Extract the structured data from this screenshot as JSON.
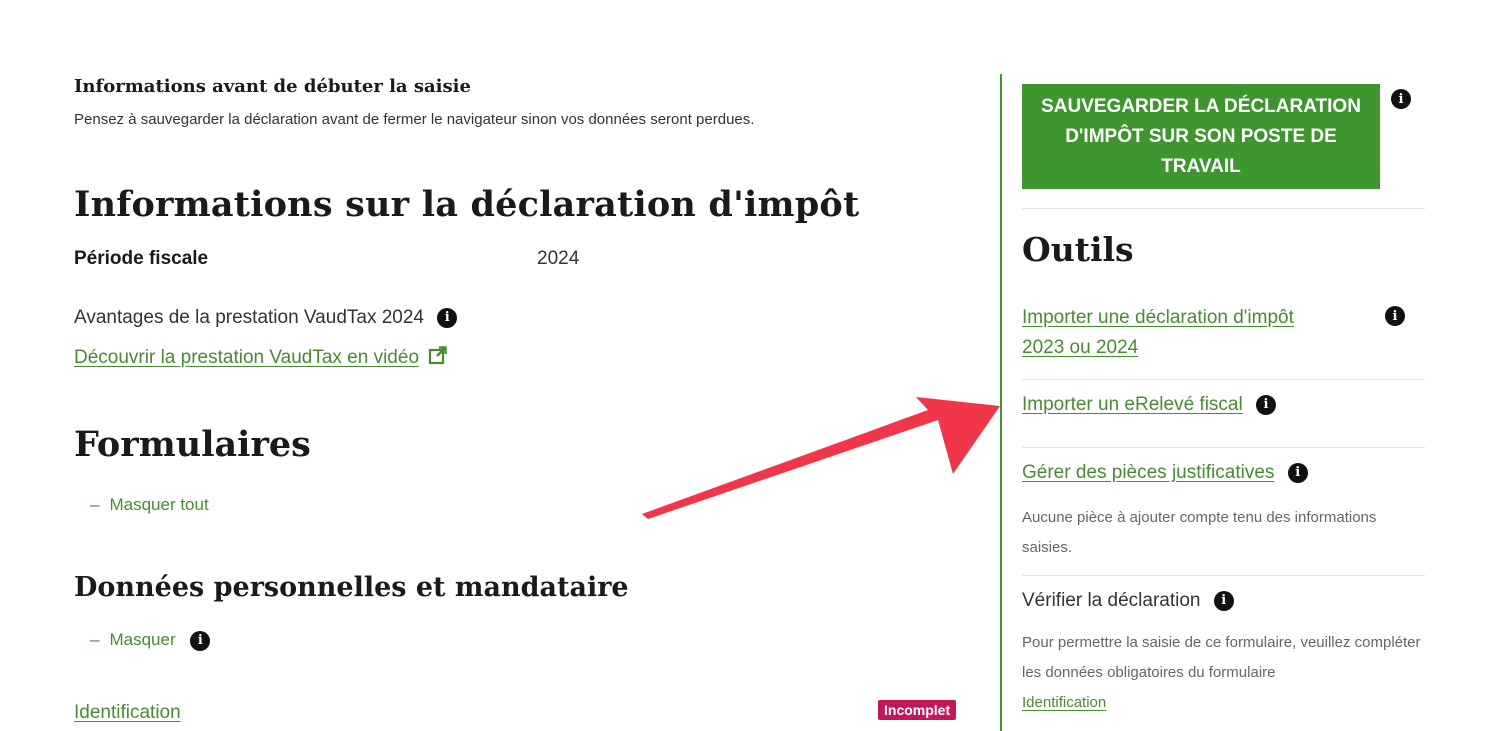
{
  "notice": {
    "title": "Informations avant de débuter la saisie",
    "text": "Pensez à sauvegarder la déclaration avant de fermer le navigateur sinon vos données seront perdues."
  },
  "declaration": {
    "heading": "Informations sur la déclaration d'impôt",
    "period_label": "Période fiscale",
    "period_value": "2024",
    "benefits_text": "Avantages de la prestation VaudTax 2024",
    "video_link": "Découvrir la prestation VaudTax en vidéo"
  },
  "forms": {
    "heading": "Formulaires",
    "collapse_all": "Masquer tout",
    "section_heading": "Données personnelles et mandataire",
    "collapse": "Masquer",
    "item_label": "Identification",
    "item_status": "Incomplet"
  },
  "sidebar": {
    "save_button": "SAUVEGARDER LA DÉCLARATION D'IMPÔT SUR SON POSTE DE TRAVAIL",
    "tools_heading": "Outils",
    "import_declaration_line1": "Importer une déclaration d'impôt",
    "import_declaration_line2": "2023 ou 2024",
    "import_ereleve": "Importer un eRelevé fiscal",
    "manage_documents": "Gérer des pièces justificatives",
    "manage_documents_note": "Aucune pièce à ajouter compte tenu des informations saisies.",
    "verify_heading": "Vérifier la déclaration",
    "verify_note": "Pour permettre la saisie de ce formulaire, veuillez compléter les données obligatoires du formulaire",
    "verify_link": "Identification"
  },
  "colors": {
    "accent_green": "#3f962f",
    "link_green": "#4a8a32",
    "badge_magenta": "#c2185b",
    "arrow_red": "#f2364a"
  }
}
